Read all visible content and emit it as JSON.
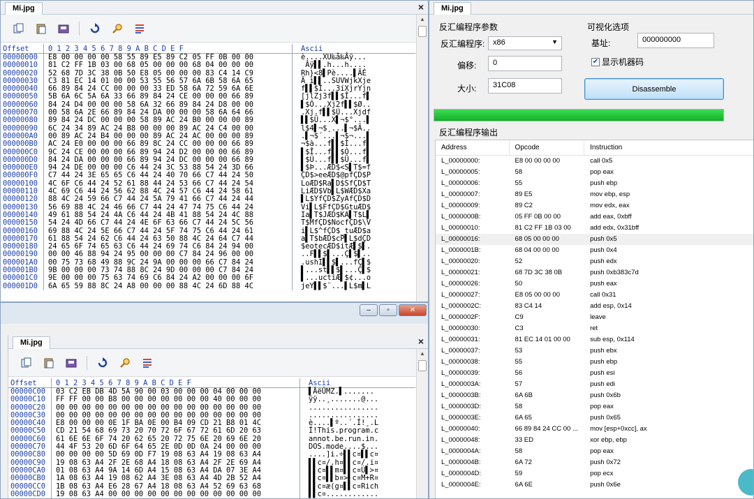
{
  "top_window": {
    "tab": "Mi.jpg",
    "close": "×",
    "hex_header": {
      "offset": "Offset",
      "hex": "0  1  2  3  4  5  6  7  8  9  A  B  C  D  E  F",
      "ascii": "Ascii"
    },
    "rows": [
      {
        "offset": "00000000",
        "hex": "E8 00 00 00 00 58 55 89 E5 89 C2 05 FF 0B 00 00",
        "ascii": "è....XU‰å‰Âÿ..."
      },
      {
        "offset": "00000010",
        "hex": "81 C2 FF 1B 03 00 68 05 00 00 00 68 04 00 00 00",
        "ascii": " Âÿ▌▌.h...h...."
      },
      {
        "offset": "00000020",
        "hex": "52 68 7D 3C 38 0B 50 E8 05 00 00 00 83 C4 14 C9",
        "ascii": "Rh}<8▌Pè....▌ÄÉ"
      },
      {
        "offset": "00000030",
        "hex": "C3 81 EC 14 01 00 00 53 55 56 57 6A 6B 58 6A 65",
        "ascii": "Ã ì▌▌..SUVWjkXje"
      },
      {
        "offset": "00000040",
        "hex": "66 89 84 24 CC 00 00 00 33 ED 58 6A 72 59 6A 6E",
        "ascii": "f▌▌$Ì...3íXjrYjn"
      },
      {
        "offset": "00000050",
        "hex": "5B 6A 6C 5A 6A 33 66 89 84 24 CE 00 00 00 66 89",
        "ascii": "[jlZj3f▌▌$Î...f▌"
      },
      {
        "offset": "00000060",
        "hex": "84 24 D4 00 00 00 58 6A 32 66 89 84 24 D8 00 00",
        "ascii": "▌$Ô...Xj2f▌▌$Ø.."
      },
      {
        "offset": "00000070",
        "hex": "00 58 6A 2E 66 89 84 24 DA 00 00 00 58 6A 64 66",
        "ascii": ".Xj.f▌▌$Ú...Xjdf"
      },
      {
        "offset": "00000080",
        "hex": "89 84 24 DC 00 00 00 58 89 AC 24 B0 00 00 00 89",
        "ascii": "▌▌$Ü...X▌¬$°...▌"
      },
      {
        "offset": "00000090",
        "hex": "6C 24 34 89 AC 24 B8 00 00 00 89 AC 24 C4 00 00",
        "ascii": "l$4▌¬$¸...▌¬$Ä.."
      },
      {
        "offset": "000000A0",
        "hex": "00 89 AC 24 B4 00 00 00 89 AC 24 AC 00 00 00 89",
        "ascii": ".▌¬$´...▌¬$¬...▌"
      },
      {
        "offset": "000000B0",
        "hex": "AC 24 E0 00 00 00 66 89 8C 24 CC 00 00 00 66 89",
        "ascii": "¬$à...f▌▌$Ì...f▌"
      },
      {
        "offset": "000000C0",
        "hex": "9C 24 CE 00 00 00 66 89 94 24 D2 00 00 00 66 89",
        "ascii": "▌$Î...f▌▌$Ò...f▌"
      },
      {
        "offset": "000000D0",
        "hex": "84 24 DA 00 00 00 66 89 94 24 DC 00 00 00 66 89",
        "ascii": "▌$Ú...f▌▌$Ü...f▌"
      },
      {
        "offset": "000000E0",
        "hex": "94 24 DE 00 00 00 C6 44 24 3C 53 88 54 24 3D 66",
        "ascii": "▌$Þ...ÆD$<S▌T$=f"
      },
      {
        "offset": "000000F0",
        "hex": "C7 44 24 3E 65 65 C6 44 24 40 70 66 C7 44 24 50",
        "ascii": "ÇD$>eeÆD$@pfÇD$P"
      },
      {
        "offset": "00000100",
        "hex": "4C 6F C6 44 24 52 61 88 44 24 53 66 C7 44 24 54",
        "ascii": "LoÆD$Ra▌D$SfÇD$T"
      },
      {
        "offset": "00000110",
        "hex": "4C 69 C6 44 24 56 62 88 4C 24 57 C6 44 24 58 61",
        "ascii": "LiÆD$Vb▌L$WÆD$Xa"
      },
      {
        "offset": "00000120",
        "hex": "88 4C 24 59 66 C7 44 24 5A 79 41 66 C7 44 24 44",
        "ascii": "▌L$YfÇD$ZyAfÇD$D"
      },
      {
        "offset": "00000130",
        "hex": "56 69 88 4C 24 46 66 C7 44 24 47 74 75 C6 44 24",
        "ascii": "Vi▌L$FfÇD$GtuÆD$"
      },
      {
        "offset": "00000140",
        "hex": "49 61 88 54 24 4A C6 44 24 4B 41 88 54 24 4C 88",
        "ascii": "Ia▌T$JÆD$KA▌T$L▌"
      },
      {
        "offset": "00000150",
        "hex": "54 24 4D 66 C7 44 24 4E 6F 63 66 C7 44 24 5C 56",
        "ascii": "T$MfÇD$NocfÇD$\\V"
      },
      {
        "offset": "00000160",
        "hex": "69 88 4C 24 5E 66 C7 44 24 5F 74 75 C6 44 24 61",
        "ascii": "i▌L$^fÇD$_tuÆD$a"
      },
      {
        "offset": "00000170",
        "hex": "61 88 54 24 62 C6 44 24 63 50 88 4C 24 64 C7 44",
        "ascii": "a▌T$bÆD$cP▌L$dÇD"
      },
      {
        "offset": "00000180",
        "hex": "24 65 6F 74 65 63 C6 44 24 69 74 C6 84 24 94 00",
        "ascii": "$eotecÆD$itÆ▌$▌."
      },
      {
        "offset": "00000190",
        "hex": "00 00 46 88 94 24 95 00 00 00 C7 84 24 96 00 00",
        "ascii": "..F▌▌$▌...Ç▌$▌.."
      },
      {
        "offset": "000001A0",
        "hex": "00 75 73 68 49 88 9C 24 9A 00 00 00 66 C7 84 24",
        "ascii": ".ushI▌▌$▌...fÇ▌$"
      },
      {
        "offset": "000001B0",
        "hex": "9B 00 00 00 73 74 88 8C 24 9D 00 00 00 C7 84 24",
        "ascii": "▌...st▌▌$▌...Ç▌$"
      },
      {
        "offset": "000001C0",
        "hex": "9E 00 00 00 75 63 74 69 C6 84 24 A2 00 00 00 6F",
        "ascii": "▌...uctiÆ▌$¢...o"
      },
      {
        "offset": "000001D0",
        "hex": "6A 65 59 88 8C 24 A8 00 00 00 88 4C 24 6D 88 4C",
        "ascii": "jeY▌▌$¨...▌L$m▌L"
      }
    ]
  },
  "bottom_window": {
    "tab": "Mi.jpg",
    "close": "×",
    "controls": {
      "minimize": "–",
      "restore": "▫",
      "close": "✕"
    },
    "hex_header": {
      "offset": "Offset",
      "hex": "0  1  2  3  4  5  6  7  8  9  A  B  C  D  E  F",
      "ascii": "Ascii"
    },
    "rows": [
      {
        "offset": "00000C00",
        "hex": "03 C2 EB DB 4D 5A 90 00 03 00 00 00 04 00 00 00",
        "ascii": "▌ÂëÛMZ.▌......."
      },
      {
        "offset": "00000C10",
        "hex": "FF FF 00 00 B8 00 00 00 00 00 00 00 40 00 00 00",
        "ascii": "ÿÿ..¸.......@..."
      },
      {
        "offset": "00000C20",
        "hex": "00 00 00 00 00 00 00 00 00 00 00 00 00 00 00 00",
        "ascii": "................"
      },
      {
        "offset": "00000C30",
        "hex": "00 00 00 00 00 00 00 00 00 00 00 00 00 00 00 00",
        "ascii": "................"
      },
      {
        "offset": "00000C40",
        "hex": "E8 00 00 00 0E 1F BA 0E 00 B4 09 CD 21 B8 01 4C",
        "ascii": "è....▌º..´.Í!¸.L"
      },
      {
        "offset": "00000C50",
        "hex": "CD 21 54 68 69 73 20 70 72 6F 67 72 61 6D 20 63",
        "ascii": "Í!This.program.c"
      },
      {
        "offset": "00000C60",
        "hex": "61 6E 6E 6F 74 20 62 65 20 72 75 6E 20 69 6E 20",
        "ascii": "annot.be.run.in."
      },
      {
        "offset": "00000C70",
        "hex": "44 4F 53 20 6D 6F 64 65 2E 0D 0D 0A 24 00 00 00",
        "ascii": "DOS.mode....$..."
      },
      {
        "offset": "00000C80",
        "hex": "00 00 00 00 5D 69 0D F7 19 08 63 A4 19 08 63 A4",
        "ascii": "....]i.÷▌▌c¤▌▌c¤"
      },
      {
        "offset": "00000C90",
        "hex": "19 08 63 A4 2F 2E 68 A4 18 08 63 A4 2F 2E 69 A4",
        "ascii": "▌▌c¤/.h¤▌▌c¤/.i¤"
      },
      {
        "offset": "00000CA0",
        "hex": "01 08 63 A4 9A 14 6D A4 15 08 63 A4 DA 07 3E A4",
        "ascii": "▌▌c¤▌▌m¤▌▌c¤Ú▌>¤"
      },
      {
        "offset": "00000CB0",
        "hex": "1A 08 63 A4 19 08 62 A4 3E 08 63 A4 4D 2B 52 A4",
        "ascii": "▌▌c¤▌▌b¤>▌c¤M+R¤"
      },
      {
        "offset": "00000CC0",
        "hex": "1B 08 63 A4 E6 28 67 A4 18 08 63 A4 52 69 63 68",
        "ascii": "▌▌c¤æ(g¤▌▌c¤Rich"
      },
      {
        "offset": "00000CD0",
        "hex": "19 08 63 A4 00 00 00 00 00 00 00 00 00 00 00 00",
        "ascii": "▌▌c¤............"
      }
    ]
  },
  "right_window": {
    "tab": "Mi.jpg",
    "params_group": "反汇编程序参数",
    "disassembler_label": "反汇编程序:",
    "disassembler_value": "x86",
    "offset_label": "偏移:",
    "offset_value": "0",
    "size_label": "大小:",
    "size_value": "31C08",
    "vis_group": "可视化选项",
    "base_label": "基址:",
    "base_value": "000000000",
    "show_machine_code": "显示机器码",
    "disassemble_button": "Disassemble",
    "progress": 1.0,
    "output_group": "反汇编程序输出",
    "columns": {
      "address": "Address",
      "opcode": "Opcode",
      "instruction": "Instruction"
    },
    "rows": [
      {
        "address": "L_00000000:",
        "opcode": "E8 00 00 00 00",
        "instruction": "call 0x5"
      },
      {
        "address": "L_00000005:",
        "opcode": "58",
        "instruction": "pop eax"
      },
      {
        "address": "L_00000006:",
        "opcode": "55",
        "instruction": "push ebp"
      },
      {
        "address": "L_00000007:",
        "opcode": "89 E5",
        "instruction": "mov ebp, esp"
      },
      {
        "address": "L_00000009:",
        "opcode": "89 C2",
        "instruction": "mov edx, eax"
      },
      {
        "address": "L_0000000B:",
        "opcode": "05 FF 0B 00 00",
        "instruction": "add eax, 0xbff"
      },
      {
        "address": "L_00000010:",
        "opcode": "81 C2 FF 1B 03 00",
        "instruction": "add edx, 0x31bff"
      },
      {
        "address": "L_00000016:",
        "opcode": "68 05 00 00 00",
        "instruction": "push 0x5"
      },
      {
        "address": "L_0000001B:",
        "opcode": "68 04 00 00 00",
        "instruction": "push 0x4"
      },
      {
        "address": "L_00000020:",
        "opcode": "52",
        "instruction": "push edx"
      },
      {
        "address": "L_00000021:",
        "opcode": "68 7D 3C 38 0B",
        "instruction": "push 0xb383c7d"
      },
      {
        "address": "L_00000026:",
        "opcode": "50",
        "instruction": "push eax"
      },
      {
        "address": "L_00000027:",
        "opcode": "E8 05 00 00 00",
        "instruction": "call 0x31"
      },
      {
        "address": "L_0000002C:",
        "opcode": "83 C4 14",
        "instruction": "add esp, 0x14"
      },
      {
        "address": "L_0000002F:",
        "opcode": "C9",
        "instruction": "leave"
      },
      {
        "address": "L_00000030:",
        "opcode": "C3",
        "instruction": "ret"
      },
      {
        "address": "L_00000031:",
        "opcode": "81 EC 14 01 00 00",
        "instruction": "sub esp, 0x114"
      },
      {
        "address": "L_00000037:",
        "opcode": "53",
        "instruction": "push ebx"
      },
      {
        "address": "L_00000038:",
        "opcode": "55",
        "instruction": "push ebp"
      },
      {
        "address": "L_00000039:",
        "opcode": "56",
        "instruction": "push esi"
      },
      {
        "address": "L_0000003A:",
        "opcode": "57",
        "instruction": "push edi"
      },
      {
        "address": "L_0000003B:",
        "opcode": "6A 6B",
        "instruction": "push 0x6b"
      },
      {
        "address": "L_0000003D:",
        "opcode": "58",
        "instruction": "pop eax"
      },
      {
        "address": "L_0000003E:",
        "opcode": "6A 65",
        "instruction": "push 0x65"
      },
      {
        "address": "L_00000040:",
        "opcode": "66 89 84 24 CC 00 ...",
        "instruction": "mov [esp+0xcc], ax"
      },
      {
        "address": "L_00000048:",
        "opcode": "33 ED",
        "instruction": "xor ebp, ebp"
      },
      {
        "address": "L_0000004A:",
        "opcode": "58",
        "instruction": "pop eax"
      },
      {
        "address": "L_0000004B:",
        "opcode": "6A 72",
        "instruction": "push 0x72"
      },
      {
        "address": "L_0000004D:",
        "opcode": "59",
        "instruction": "pop ecx"
      },
      {
        "address": "L_0000004E:",
        "opcode": "6A 6E",
        "instruction": "push 0x6e"
      }
    ]
  }
}
